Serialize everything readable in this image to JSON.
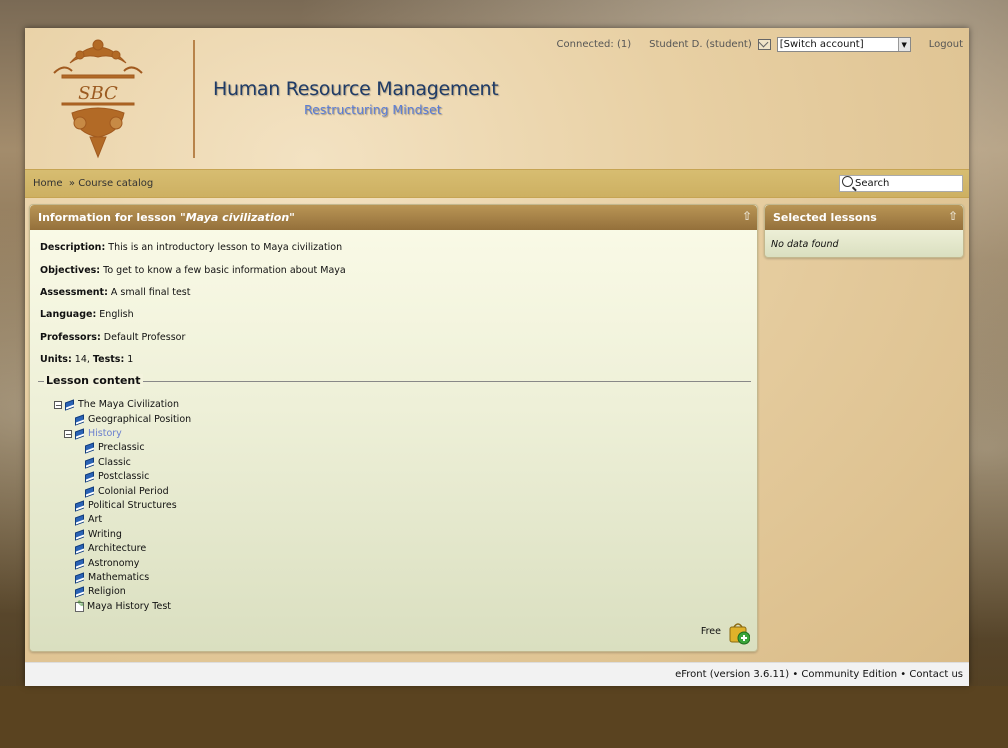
{
  "header": {
    "connected_label": "Connected: (1)",
    "user_label": "Student D. (student)",
    "switch_account": "[Switch account]",
    "logout": "Logout",
    "title": "Human Resource Management",
    "subtitle": "Restructuring Mindset",
    "logo_text": "SBC"
  },
  "breadcrumb": {
    "home": "Home",
    "separator": "»",
    "current": "Course catalog"
  },
  "search": {
    "label": "Search"
  },
  "lesson_panel": {
    "title_prefix": "Information for lesson",
    "title_lesson": "\"Maya civilization\"",
    "description_label": "Description",
    "description": "This is an introductory lesson to Maya civilization",
    "objectives_label": "Objectives",
    "objectives": "To get to know a few basic information about Maya",
    "assessment_label": "Assessment",
    "assessment": "A small final test",
    "language_label": "Language",
    "language": "English",
    "professors_label": "Professors",
    "professors": "Default Professor",
    "units_label": "Units",
    "units": "14",
    "tests_label": "Tests",
    "tests": "1",
    "content_title": "Lesson content",
    "tree": [
      {
        "label": "The Maya Civilization"
      },
      {
        "label": "Geographical Position"
      },
      {
        "label": "History"
      },
      {
        "label": "Preclassic"
      },
      {
        "label": "Classic"
      },
      {
        "label": "Postclassic"
      },
      {
        "label": "Colonial Period"
      },
      {
        "label": "Political Structures"
      },
      {
        "label": "Art"
      },
      {
        "label": "Writing"
      },
      {
        "label": "Architecture"
      },
      {
        "label": "Astronomy"
      },
      {
        "label": "Mathematics"
      },
      {
        "label": "Religion"
      },
      {
        "label": "Maya History Test"
      }
    ],
    "price": "Free"
  },
  "selected_panel": {
    "title": "Selected lessons",
    "empty": "No data found"
  },
  "footer": {
    "version": "eFront (version 3.6.11)",
    "edition": "Community Edition",
    "contact": "Contact us",
    "separator": "•"
  },
  "colors": {
    "panel_header": "#a5814a",
    "title_text": "#1f3b66",
    "subtitle_text": "#5b7dd6",
    "navbar": "#d2b767"
  }
}
